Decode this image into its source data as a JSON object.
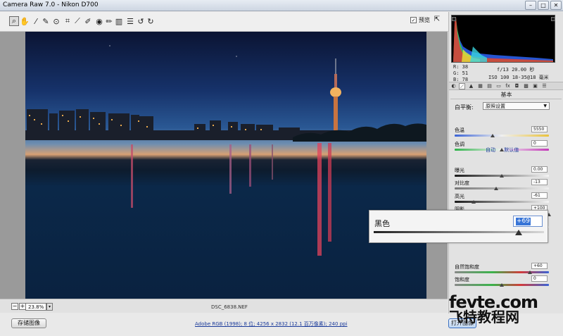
{
  "window": {
    "title": "Camera Raw 7.0 - Nikon D700"
  },
  "toolbar": {
    "tools": [
      "zoom-tool-icon",
      "hand-tool-icon",
      "white-balance-tool-icon",
      "color-sampler-icon",
      "target-adjust-icon",
      "crop-icon",
      "straighten-icon",
      "spot-removal-icon",
      "red-eye-icon",
      "adjustment-brush-icon",
      "graduated-filter-icon",
      "preferences-icon",
      "rotate-ccw-icon",
      "rotate-cw-icon"
    ],
    "preview_label": "预览",
    "preview_checked": "✓"
  },
  "readout": {
    "r": "R:  38",
    "g": "G:  51",
    "b": "B:  78",
    "exif1": "f/13   20.00 秒",
    "exif2": "ISO 100   18-35@18 毫米"
  },
  "panel": {
    "section_title": "基本",
    "wb_label": "白平衡:",
    "wb_value": "原照设置",
    "auto": "自动",
    "default": "默认值"
  },
  "sliders": [
    {
      "label": "色温",
      "value": "5550",
      "pos": 0.4
    },
    {
      "label": "色调",
      "value": "0",
      "pos": 0.5
    },
    {
      "label": "曝光",
      "value": "0.00",
      "pos": 0.5
    },
    {
      "label": "对比度",
      "value": "-13",
      "pos": 0.44
    },
    {
      "label": "高光",
      "value": "-61",
      "pos": 0.2
    },
    {
      "label": "阴影",
      "value": "+100",
      "pos": 1.0
    },
    {
      "label": "白色",
      "value": "+36",
      "pos": 0.68
    },
    {
      "label": "自然饱和度",
      "value": "+60",
      "pos": 0.8
    },
    {
      "label": "饱和度",
      "value": "0",
      "pos": 0.5
    }
  ],
  "zoomed_slider": {
    "label": "黑色",
    "value": "+69",
    "pos": 0.85
  },
  "bottom": {
    "zoom_value": "23.8%",
    "filename": "DSC_6838.NEF",
    "save_label": "存储图像",
    "workflow": "Adobe RGB (1998); 8 位; 4256 x 2832 (12.1 百万像素); 240 ppi",
    "open_label": "打开图像"
  },
  "watermark": {
    "line1": "fevte.com",
    "line2": "飞特教程网"
  }
}
